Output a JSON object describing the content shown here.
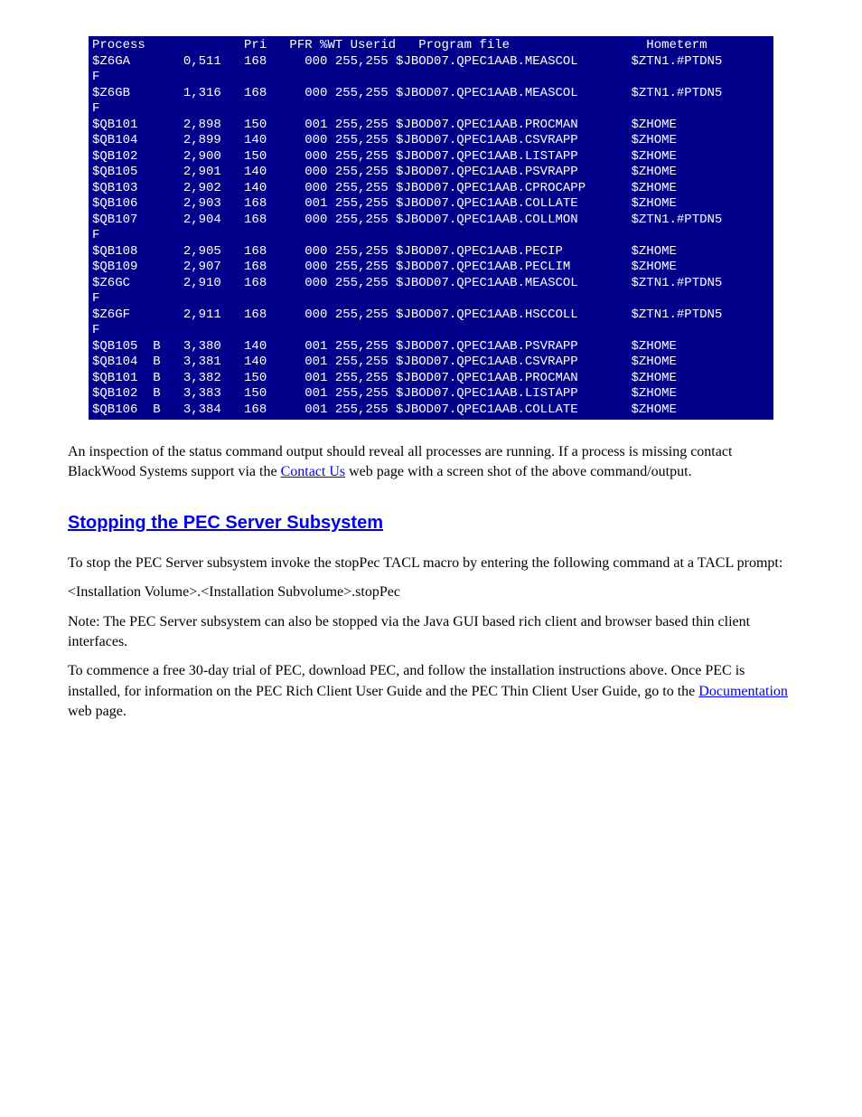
{
  "terminal": {
    "headers": {
      "process": "Process",
      "pri": "Pri",
      "pfr": "PFR",
      "wt": "%WT",
      "userid": "Userid",
      "program": "Program file",
      "hometerm": "Hometerm"
    },
    "rows": [
      {
        "proc": "$Z6GA",
        "b": "",
        "pid": "0,511",
        "pri": "168",
        "pfr": "",
        "wt": "000",
        "uid": "255,255",
        "prog": "$JBOD07.QPEC1AAB.MEASCOL",
        "home": "$ZTN1.#PTDN5",
        "wrap": "F"
      },
      {
        "proc": "$Z6GB",
        "b": "",
        "pid": "1,316",
        "pri": "168",
        "pfr": "",
        "wt": "000",
        "uid": "255,255",
        "prog": "$JBOD07.QPEC1AAB.MEASCOL",
        "home": "$ZTN1.#PTDN5",
        "wrap": "F"
      },
      {
        "proc": "$QB101",
        "b": "",
        "pid": "2,898",
        "pri": "150",
        "pfr": "",
        "wt": "001",
        "uid": "255,255",
        "prog": "$JBOD07.QPEC1AAB.PROCMAN",
        "home": "$ZHOME",
        "wrap": ""
      },
      {
        "proc": "$QB104",
        "b": "",
        "pid": "2,899",
        "pri": "140",
        "pfr": "",
        "wt": "000",
        "uid": "255,255",
        "prog": "$JBOD07.QPEC1AAB.CSVRAPP",
        "home": "$ZHOME",
        "wrap": ""
      },
      {
        "proc": "$QB102",
        "b": "",
        "pid": "2,900",
        "pri": "150",
        "pfr": "",
        "wt": "000",
        "uid": "255,255",
        "prog": "$JBOD07.QPEC1AAB.LISTAPP",
        "home": "$ZHOME",
        "wrap": ""
      },
      {
        "proc": "$QB105",
        "b": "",
        "pid": "2,901",
        "pri": "140",
        "pfr": "",
        "wt": "000",
        "uid": "255,255",
        "prog": "$JBOD07.QPEC1AAB.PSVRAPP",
        "home": "$ZHOME",
        "wrap": ""
      },
      {
        "proc": "$QB103",
        "b": "",
        "pid": "2,902",
        "pri": "140",
        "pfr": "",
        "wt": "000",
        "uid": "255,255",
        "prog": "$JBOD07.QPEC1AAB.CPROCAPP",
        "home": "$ZHOME",
        "wrap": ""
      },
      {
        "proc": "$QB106",
        "b": "",
        "pid": "2,903",
        "pri": "168",
        "pfr": "",
        "wt": "001",
        "uid": "255,255",
        "prog": "$JBOD07.QPEC1AAB.COLLATE",
        "home": "$ZHOME",
        "wrap": ""
      },
      {
        "proc": "$QB107",
        "b": "",
        "pid": "2,904",
        "pri": "168",
        "pfr": "",
        "wt": "000",
        "uid": "255,255",
        "prog": "$JBOD07.QPEC1AAB.COLLMON",
        "home": "$ZTN1.#PTDN5",
        "wrap": "F"
      },
      {
        "proc": "$QB108",
        "b": "",
        "pid": "2,905",
        "pri": "168",
        "pfr": "",
        "wt": "000",
        "uid": "255,255",
        "prog": "$JBOD07.QPEC1AAB.PECIP",
        "home": "$ZHOME",
        "wrap": ""
      },
      {
        "proc": "$QB109",
        "b": "",
        "pid": "2,907",
        "pri": "168",
        "pfr": "",
        "wt": "000",
        "uid": "255,255",
        "prog": "$JBOD07.QPEC1AAB.PECLIM",
        "home": "$ZHOME",
        "wrap": ""
      },
      {
        "proc": "$Z6GC",
        "b": "",
        "pid": "2,910",
        "pri": "168",
        "pfr": "",
        "wt": "000",
        "uid": "255,255",
        "prog": "$JBOD07.QPEC1AAB.MEASCOL",
        "home": "$ZTN1.#PTDN5",
        "wrap": "F"
      },
      {
        "proc": "$Z6GF",
        "b": "",
        "pid": "2,911",
        "pri": "168",
        "pfr": "",
        "wt": "000",
        "uid": "255,255",
        "prog": "$JBOD07.QPEC1AAB.HSCCOLL",
        "home": "$ZTN1.#PTDN5",
        "wrap": "F"
      },
      {
        "proc": "$QB105",
        "b": "B",
        "pid": "3,380",
        "pri": "140",
        "pfr": "",
        "wt": "001",
        "uid": "255,255",
        "prog": "$JBOD07.QPEC1AAB.PSVRAPP",
        "home": "$ZHOME",
        "wrap": ""
      },
      {
        "proc": "$QB104",
        "b": "B",
        "pid": "3,381",
        "pri": "140",
        "pfr": "",
        "wt": "001",
        "uid": "255,255",
        "prog": "$JBOD07.QPEC1AAB.CSVRAPP",
        "home": "$ZHOME",
        "wrap": ""
      },
      {
        "proc": "$QB101",
        "b": "B",
        "pid": "3,382",
        "pri": "150",
        "pfr": "",
        "wt": "001",
        "uid": "255,255",
        "prog": "$JBOD07.QPEC1AAB.PROCMAN",
        "home": "$ZHOME",
        "wrap": ""
      },
      {
        "proc": "$QB102",
        "b": "B",
        "pid": "3,383",
        "pri": "150",
        "pfr": "",
        "wt": "001",
        "uid": "255,255",
        "prog": "$JBOD07.QPEC1AAB.LISTAPP",
        "home": "$ZHOME",
        "wrap": ""
      },
      {
        "proc": "$QB106",
        "b": "B",
        "pid": "3,384",
        "pri": "168",
        "pfr": "",
        "wt": "001",
        "uid": "255,255",
        "prog": "$JBOD07.QPEC1AAB.COLLATE",
        "home": "$ZHOME",
        "wrap": ""
      }
    ]
  },
  "body": {
    "p1a": "An inspection of the status command output should reveal all processes are running. If a process is missing contact BlackWood Systems support via the ",
    "p1_link": "Contact Us",
    "p1b": " web page with a screen shot of the above command/output.",
    "h_stop": "Stopping the PEC Server Subsystem",
    "p2": "To stop the PEC Server subsystem invoke the stopPec TACL macro by entering the following command at a TACL prompt:",
    "p3": "<Installation Volume>.<Installation Subvolume>.stopPec",
    "p4": "Note: The PEC Server subsystem can also be stopped via the Java GUI based rich client and browser based thin client interfaces.",
    "p5a": "To commence a free 30-day trial of PEC, download PEC, and follow the installation instructions above. Once PEC is installed, for information on the PEC Rich Client User Guide and the PEC Thin Client User Guide, go to the ",
    "p5_link": "Documentation",
    "p5b": " web page."
  }
}
